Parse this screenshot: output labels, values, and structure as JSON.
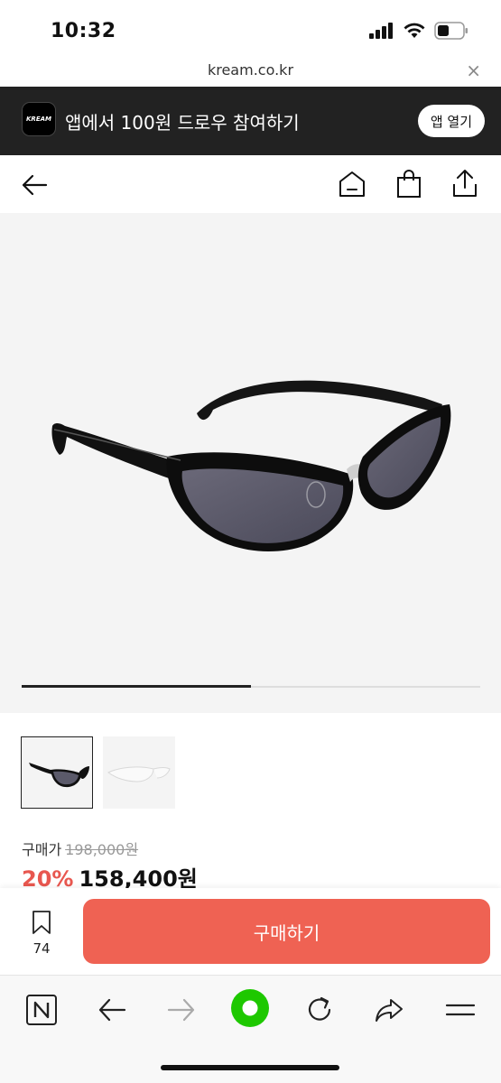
{
  "status": {
    "time": "10:32"
  },
  "browser": {
    "url": "kream.co.kr",
    "close_glyph": "×"
  },
  "banner": {
    "logo_text": "KREAM",
    "text": "앱에서 100원 드로우 참여하기",
    "button_label": "앱 열기"
  },
  "navbar": {
    "icons": [
      "back-arrow-icon",
      "home-icon",
      "shopping-bag-icon",
      "share-icon"
    ]
  },
  "gallery": {
    "progress": 0.5,
    "thumbnail_count": 2,
    "selected_thumbnail": 0
  },
  "price": {
    "label": "구매가",
    "original": "198,000원",
    "discount": "20%",
    "final": "158,400원"
  },
  "bottom": {
    "wish_count": "74",
    "buy_label": "구매하기"
  },
  "colors": {
    "accent": "#ef6253",
    "discount": "#e8574f",
    "banner_bg": "#222222",
    "browser_green": "#1ec800"
  }
}
